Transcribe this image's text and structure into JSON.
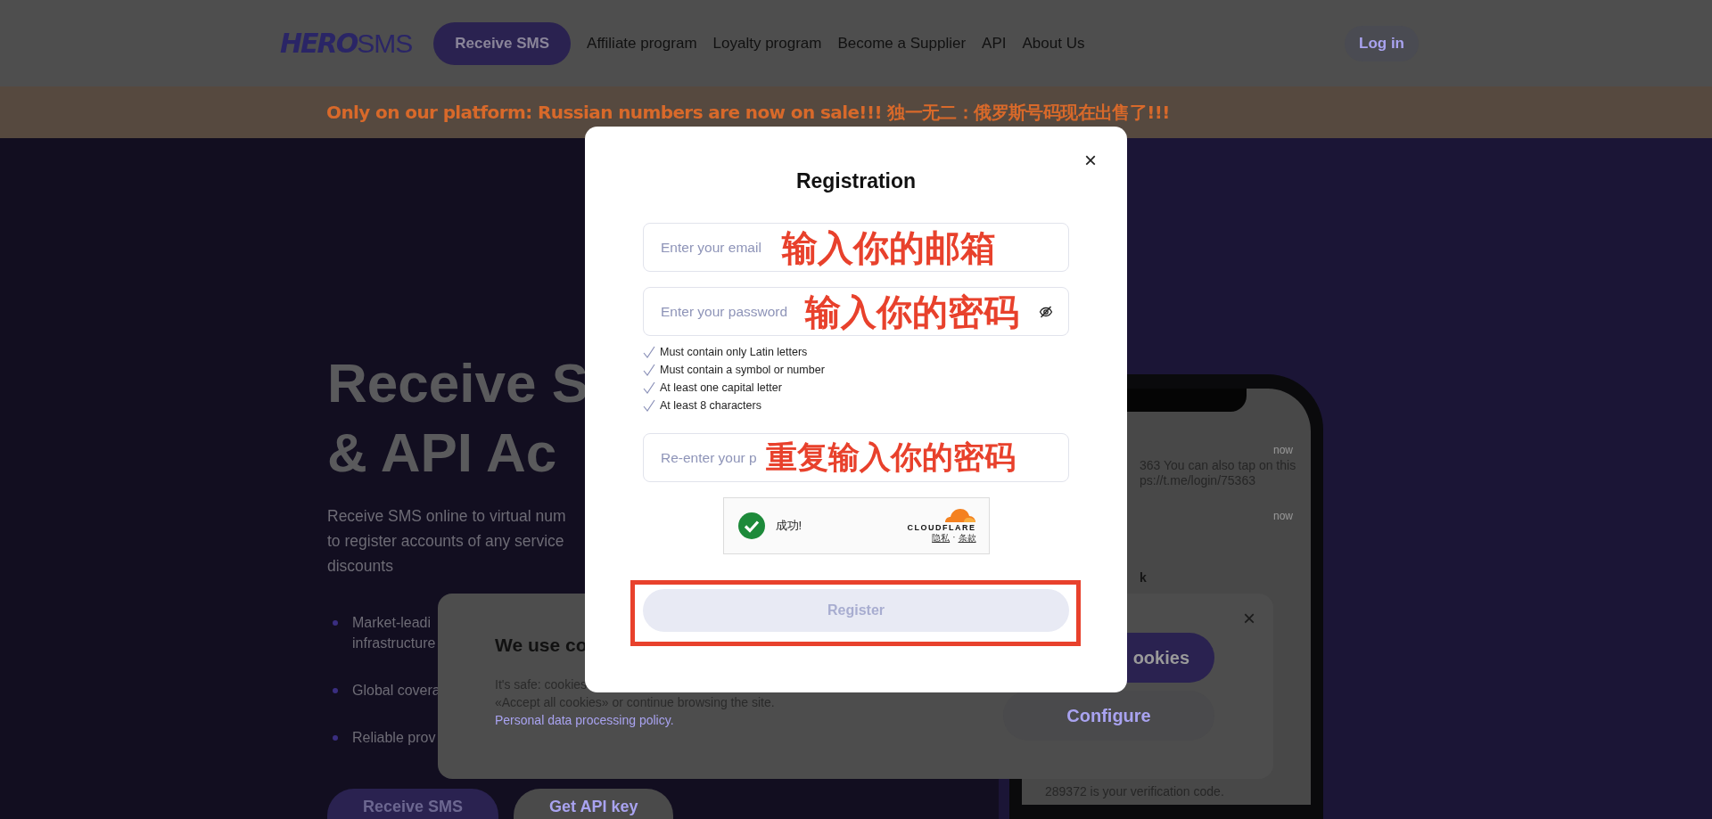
{
  "header": {
    "logo": {
      "bold": "HERO",
      "light": "SMS"
    },
    "nav": [
      {
        "label": "Receive SMS",
        "kind": "button"
      },
      {
        "label": "Affiliate program",
        "kind": "link"
      },
      {
        "label": "Loyalty program",
        "kind": "link"
      },
      {
        "label": "Become a Supplier",
        "kind": "link"
      },
      {
        "label": "API",
        "kind": "link"
      },
      {
        "label": "About Us",
        "kind": "link"
      }
    ],
    "login": "Log in"
  },
  "announcement": "Only on our platform: Russian numbers are now on sale!!! 独一无二：俄罗斯号码现在出售了!!!",
  "hero": {
    "title_lines": [
      "Receive S",
      "& API Ac"
    ],
    "description_lines": [
      "Receive SMS online to virtual num",
      "to register accounts of any service",
      "discounts"
    ],
    "features": [
      {
        "lines": [
          "Market-leadi",
          "infrastructure"
        ]
      },
      {
        "lines": [
          "Global covera"
        ]
      },
      {
        "lines": [
          "Reliable prov"
        ]
      }
    ],
    "buttons": [
      {
        "label": "Receive SMS",
        "kind": "primary"
      },
      {
        "label": "Get API key",
        "kind": "secondary"
      }
    ]
  },
  "phone": {
    "notifications": [
      {
        "time": "now",
        "lines": [
          "363 You can also tap on this",
          "ps://t.me/login/75363"
        ]
      },
      {
        "time": "now",
        "title": "k"
      },
      {
        "lines": [
          "289372 is your verification code."
        ]
      }
    ]
  },
  "cookie_banner": {
    "title": "We use co",
    "first_line": "It's safe: cookies",
    "text": "«Accept all cookies» or continue browsing the site.",
    "link": "Personal data processing policy.",
    "close": "×",
    "buttons": [
      {
        "label": "ookies",
        "kind": "primary"
      },
      {
        "label": "Configure",
        "kind": "secondary"
      }
    ]
  },
  "registration": {
    "title": "Registration",
    "close": "×",
    "fields": [
      {
        "kind": "email",
        "placeholder": "Enter your email",
        "annotation": "输入你的邮箱"
      },
      {
        "kind": "password",
        "placeholder": "Enter your password",
        "annotation": "输入你的密码",
        "eye_toggle": true
      },
      {
        "kind": "repeat",
        "placeholder": "Re-enter your p",
        "annotation": "重复输入你的密码"
      }
    ],
    "requirements": [
      "Must contain only Latin letters",
      "Must contain a symbol or number",
      "At least one capital letter",
      "At least 8 characters"
    ],
    "captcha": {
      "verified": true,
      "status": "成功!",
      "brand": "CLOUDFLARE",
      "links": [
        "隐私",
        "条款"
      ],
      "separator": "·"
    },
    "submit": {
      "label": "Register",
      "disabled": true,
      "highlighted": true
    }
  }
}
